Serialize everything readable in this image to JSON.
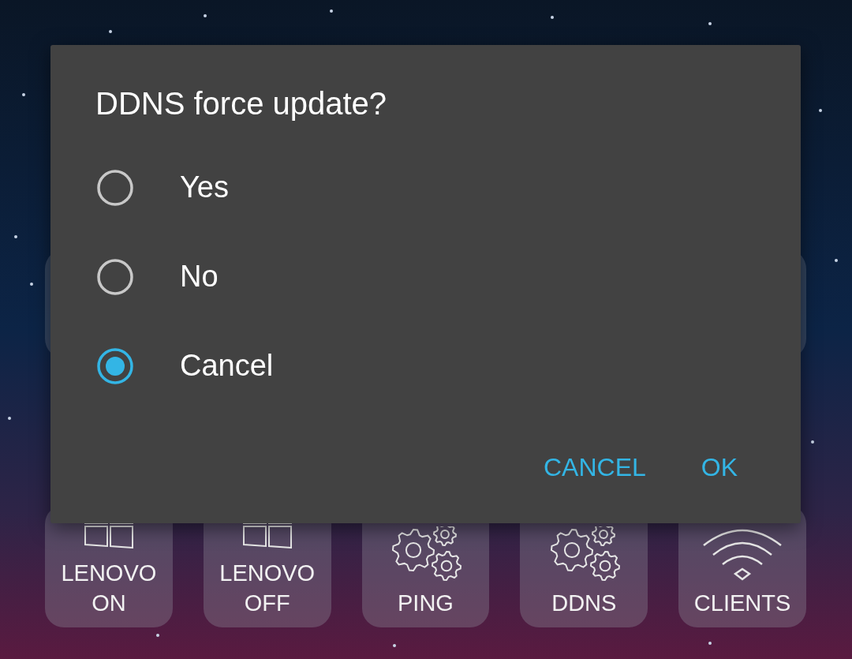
{
  "dialog": {
    "title": "DDNS force update?",
    "options": [
      {
        "label": "Yes",
        "selected": false
      },
      {
        "label": "No",
        "selected": false
      },
      {
        "label": "Cancel",
        "selected": true
      }
    ],
    "buttons": [
      "CANCEL",
      "OK"
    ]
  },
  "tiles": [
    {
      "label": "LENOVO ON",
      "kind": "windows"
    },
    {
      "label": "LENOVO OFF",
      "kind": "windows"
    },
    {
      "label": "PING",
      "kind": "gears"
    },
    {
      "label": "DDNS",
      "kind": "gears"
    },
    {
      "label": "CLIENTS",
      "kind": "wifi"
    }
  ]
}
